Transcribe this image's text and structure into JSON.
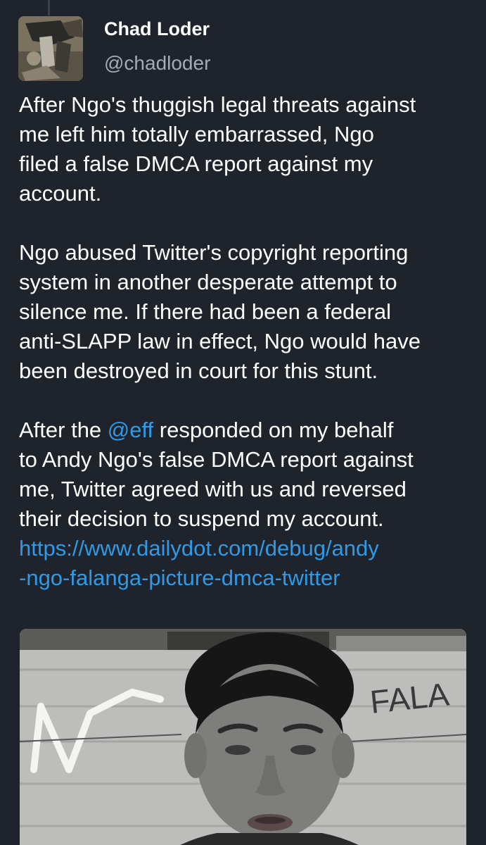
{
  "user": {
    "display_name": "Chad Loder",
    "handle": "@chadloder"
  },
  "tweet": {
    "lines_p1": [
      "After Ngo's thuggish legal threats against",
      "me left him totally embarrassed, Ngo",
      "filed a false DMCA report against my",
      "account."
    ],
    "lines_p2": [
      "Ngo abused Twitter's copyright reporting",
      "system in another desperate attempt to",
      "silence me. If there had been a federal",
      "anti-SLAPP law in effect, Ngo would have",
      "been destroyed in court for this stunt."
    ],
    "p3_line1_before": "After the ",
    "p3_mention": "@eff",
    "p3_line1_after": " responded on my behalf",
    "lines_p3_rest": [
      "to Andy Ngo's false DMCA report against",
      "me, Twitter agreed with us and reversed",
      "their decision to suspend my account."
    ],
    "link_line1": "https://www.dailydot.com/debug/andy",
    "link_line2": "-ngo-falanga-picture-dmca-twitter"
  },
  "media": {
    "graffiti_text": "FALA"
  },
  "colors": {
    "background": "#1f232b",
    "text": "#ffffff",
    "secondary_text": "#a3abb6",
    "link": "#2f9ae8"
  }
}
